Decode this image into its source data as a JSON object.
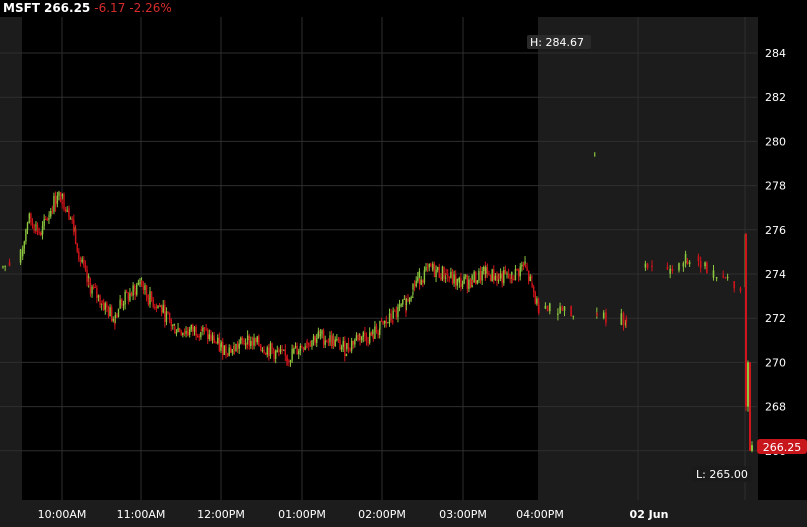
{
  "header": {
    "symbol": "MSFT",
    "last": "266.25",
    "change": "-6.17",
    "change_pct": "-2.26%"
  },
  "colors": {
    "up": "#8cc63f",
    "down": "#d0141b",
    "background": "#000000",
    "extended_hours": "#1c1c1c",
    "grid": "#2e2e2e",
    "last_tag": "#c8161d"
  },
  "chart_data": {
    "type": "candlestick",
    "title": "",
    "ylim": [
      265,
      285
    ],
    "y_ticks": [
      "284",
      "282",
      "280",
      "278",
      "276",
      "274",
      "272",
      "270",
      "268",
      "266"
    ],
    "x_ticks": [
      "10:00AM",
      "11:00AM",
      "12:00PM",
      "01:00PM",
      "02:00PM",
      "03:00PM",
      "04:00PM",
      "02 Jun"
    ],
    "high_label": "H: 284.67",
    "low_label": "L: 265.00",
    "last_price_label": "266.25",
    "grid": true,
    "price_path": [
      [
        "06-01 09:15",
        274.3
      ],
      [
        "06-01 09:30",
        274.8
      ],
      [
        "06-01 09:35",
        276.5
      ],
      [
        "06-01 09:40",
        276.2
      ],
      [
        "06-01 09:45",
        275.8
      ],
      [
        "06-01 09:50",
        276.6
      ],
      [
        "06-01 09:55",
        277.3
      ],
      [
        "06-01 10:00",
        277.5
      ],
      [
        "06-01 10:05",
        277.0
      ],
      [
        "06-01 10:10",
        276.0
      ],
      [
        "06-01 10:15",
        274.6
      ],
      [
        "06-01 10:20",
        273.6
      ],
      [
        "06-01 10:30",
        272.8
      ],
      [
        "06-01 10:40",
        272.0
      ],
      [
        "06-01 10:45",
        272.7
      ],
      [
        "06-01 10:55",
        273.2
      ],
      [
        "06-01 11:00",
        273.7
      ],
      [
        "06-01 11:05",
        273.0
      ],
      [
        "06-01 11:15",
        272.5
      ],
      [
        "06-01 11:25",
        271.6
      ],
      [
        "06-01 11:35",
        271.4
      ],
      [
        "06-01 11:45",
        271.5
      ],
      [
        "06-01 11:55",
        271.0
      ],
      [
        "06-01 12:00",
        270.7
      ],
      [
        "06-01 12:10",
        270.6
      ],
      [
        "06-01 12:20",
        271.0
      ],
      [
        "06-01 12:30",
        270.8
      ],
      [
        "06-01 12:40",
        270.5
      ],
      [
        "06-01 12:50",
        270.2
      ],
      [
        "06-01 12:55",
        270.4
      ],
      [
        "06-01 13:05",
        270.9
      ],
      [
        "06-01 13:15",
        271.2
      ],
      [
        "06-01 13:25",
        271.0
      ],
      [
        "06-01 13:35",
        270.6
      ],
      [
        "06-01 13:45",
        271.2
      ],
      [
        "06-01 13:55",
        271.2
      ],
      [
        "06-01 14:00",
        271.5
      ],
      [
        "06-01 14:10",
        272.0
      ],
      [
        "06-01 14:20",
        272.6
      ],
      [
        "06-01 14:25",
        273.3
      ],
      [
        "06-01 14:30",
        273.8
      ],
      [
        "06-01 14:40",
        274.2
      ],
      [
        "06-01 14:50",
        274.0
      ],
      [
        "06-01 15:00",
        273.6
      ],
      [
        "06-01 15:10",
        273.7
      ],
      [
        "06-01 15:20",
        274.0
      ],
      [
        "06-01 15:30",
        273.9
      ],
      [
        "06-01 15:40",
        273.8
      ],
      [
        "06-01 15:50",
        274.4
      ],
      [
        "06-01 15:55",
        273.6
      ],
      [
        "06-01 16:00",
        272.6
      ],
      [
        "06-01 16:30",
        272.4
      ],
      [
        "06-01 17:30",
        272.3
      ],
      [
        "06-01 18:15",
        279.4
      ],
      [
        "06-01 18:20",
        272.2
      ],
      [
        "06-01 19:30",
        272.0
      ],
      [
        "06-01 20:00",
        271.6
      ],
      [
        "06-02 04:00",
        274.6
      ],
      [
        "06-02 05:30",
        274.2
      ],
      [
        "06-02 06:30",
        274.6
      ],
      [
        "06-02 07:30",
        274.5
      ],
      [
        "06-02 08:00",
        273.8
      ],
      [
        "06-02 09:00",
        273.7
      ],
      [
        "06-02 09:29",
        273.4
      ],
      [
        "06-02 09:30",
        275.8
      ],
      [
        "06-02 09:31",
        268.0
      ],
      [
        "06-02 09:32",
        270.0
      ],
      [
        "06-02 09:33",
        266.0
      ],
      [
        "06-02 09:35",
        266.25
      ]
    ]
  }
}
